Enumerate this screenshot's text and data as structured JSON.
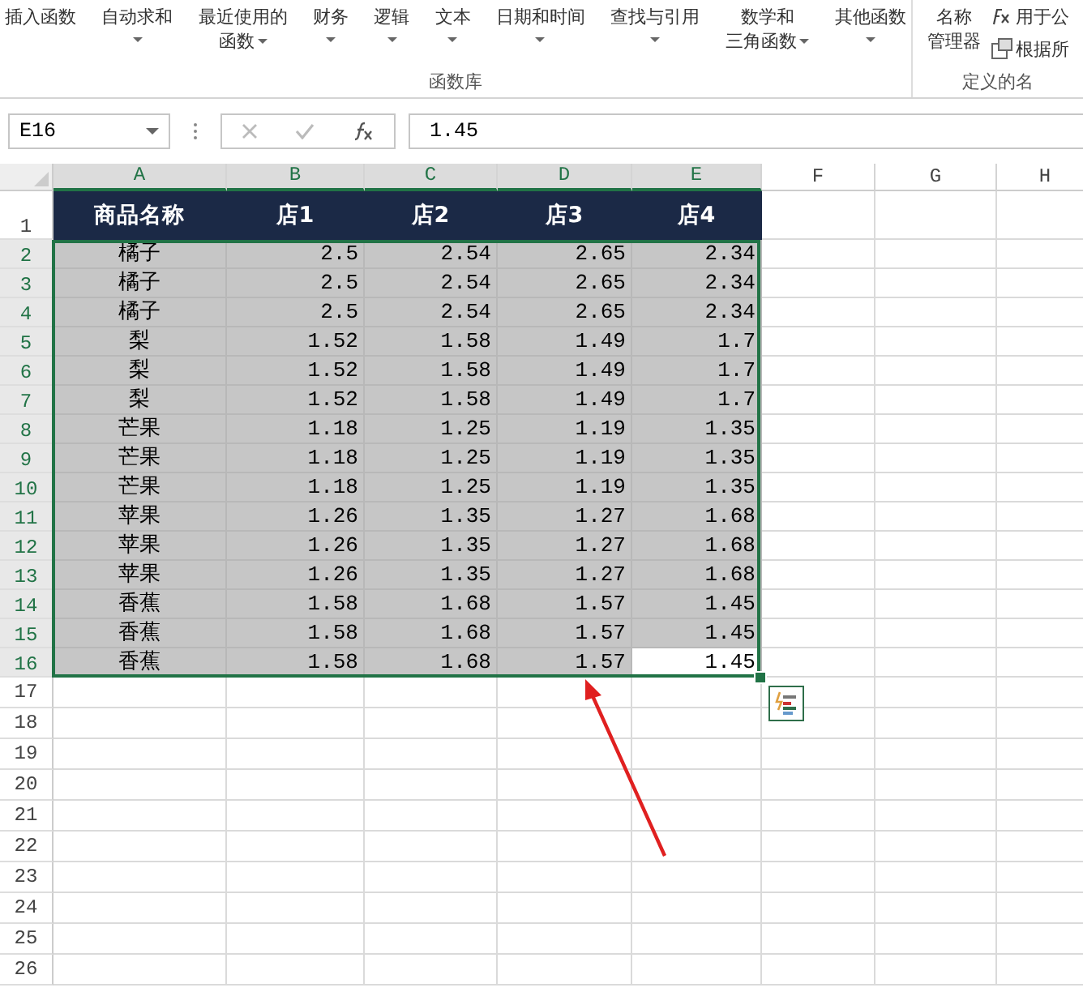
{
  "ribbon": {
    "groups": [
      {
        "label": "函数库",
        "items": [
          {
            "kind": "large",
            "lines": [
              "插入函数"
            ],
            "dropdown": false
          },
          {
            "kind": "large",
            "lines": [
              "自动求和"
            ],
            "dropdown": true
          },
          {
            "kind": "large",
            "lines": [
              "最近使用的",
              "函数"
            ],
            "dropdown": true
          },
          {
            "kind": "large",
            "lines": [
              "财务"
            ],
            "dropdown": true
          },
          {
            "kind": "large",
            "lines": [
              "逻辑"
            ],
            "dropdown": true
          },
          {
            "kind": "large",
            "lines": [
              "文本"
            ],
            "dropdown": true
          },
          {
            "kind": "large",
            "lines": [
              "日期和时间"
            ],
            "dropdown": true
          },
          {
            "kind": "large",
            "lines": [
              "查找与引用"
            ],
            "dropdown": true
          },
          {
            "kind": "large",
            "lines": [
              "数学和",
              "三角函数"
            ],
            "dropdown": true
          },
          {
            "kind": "large",
            "lines": [
              "其他函数"
            ],
            "dropdown": true
          }
        ]
      },
      {
        "label": "定义的名",
        "items": [
          {
            "kind": "large",
            "lines": [
              "名称",
              "管理器"
            ],
            "dropdown": false
          },
          {
            "kind": "small",
            "lines": [
              "用于公"
            ],
            "dropdown": false
          },
          {
            "kind": "small",
            "lines": [
              "根据所"
            ],
            "dropdown": false
          }
        ]
      }
    ]
  },
  "formula_bar": {
    "name_box": "E16",
    "value": "1.45"
  },
  "columns": [
    {
      "label": "A",
      "selected": true
    },
    {
      "label": "B",
      "selected": true
    },
    {
      "label": "C",
      "selected": true
    },
    {
      "label": "D",
      "selected": true
    },
    {
      "label": "E",
      "selected": true
    },
    {
      "label": "F",
      "selected": false
    },
    {
      "label": "G",
      "selected": false
    },
    {
      "label": "H",
      "selected": false
    }
  ],
  "header_row": {
    "number": "1",
    "cells": [
      "商品名称",
      "店1",
      "店2",
      "店3",
      "店4"
    ]
  },
  "rows": [
    {
      "number": "2",
      "cells": [
        {
          "text": "橘子",
          "selected": true
        },
        {
          "text": "2.5",
          "selected": true
        },
        {
          "text": "2.54",
          "selected": true
        },
        {
          "text": "2.65",
          "selected": true
        },
        {
          "text": "2.34",
          "selected": true
        }
      ]
    },
    {
      "number": "3",
      "cells": [
        {
          "text": "橘子",
          "selected": true
        },
        {
          "text": "2.5",
          "selected": true
        },
        {
          "text": "2.54",
          "selected": true
        },
        {
          "text": "2.65",
          "selected": true
        },
        {
          "text": "2.34",
          "selected": true
        }
      ]
    },
    {
      "number": "4",
      "cells": [
        {
          "text": "橘子",
          "selected": true
        },
        {
          "text": "2.5",
          "selected": true
        },
        {
          "text": "2.54",
          "selected": true
        },
        {
          "text": "2.65",
          "selected": true
        },
        {
          "text": "2.34",
          "selected": true
        }
      ]
    },
    {
      "number": "5",
      "cells": [
        {
          "text": "梨",
          "selected": true
        },
        {
          "text": "1.52",
          "selected": true
        },
        {
          "text": "1.58",
          "selected": true
        },
        {
          "text": "1.49",
          "selected": true
        },
        {
          "text": "1.7",
          "selected": true
        }
      ]
    },
    {
      "number": "6",
      "cells": [
        {
          "text": "梨",
          "selected": true
        },
        {
          "text": "1.52",
          "selected": true
        },
        {
          "text": "1.58",
          "selected": true
        },
        {
          "text": "1.49",
          "selected": true
        },
        {
          "text": "1.7",
          "selected": true
        }
      ]
    },
    {
      "number": "7",
      "cells": [
        {
          "text": "梨",
          "selected": true
        },
        {
          "text": "1.52",
          "selected": true
        },
        {
          "text": "1.58",
          "selected": true
        },
        {
          "text": "1.49",
          "selected": true
        },
        {
          "text": "1.7",
          "selected": true
        }
      ]
    },
    {
      "number": "8",
      "cells": [
        {
          "text": "芒果",
          "selected": true
        },
        {
          "text": "1.18",
          "selected": true
        },
        {
          "text": "1.25",
          "selected": true
        },
        {
          "text": "1.19",
          "selected": true
        },
        {
          "text": "1.35",
          "selected": true
        }
      ]
    },
    {
      "number": "9",
      "cells": [
        {
          "text": "芒果",
          "selected": true
        },
        {
          "text": "1.18",
          "selected": true
        },
        {
          "text": "1.25",
          "selected": true
        },
        {
          "text": "1.19",
          "selected": true
        },
        {
          "text": "1.35",
          "selected": true
        }
      ]
    },
    {
      "number": "10",
      "cells": [
        {
          "text": "芒果",
          "selected": true
        },
        {
          "text": "1.18",
          "selected": true
        },
        {
          "text": "1.25",
          "selected": true
        },
        {
          "text": "1.19",
          "selected": true
        },
        {
          "text": "1.35",
          "selected": true
        }
      ]
    },
    {
      "number": "11",
      "cells": [
        {
          "text": "苹果",
          "selected": true
        },
        {
          "text": "1.26",
          "selected": true
        },
        {
          "text": "1.35",
          "selected": true
        },
        {
          "text": "1.27",
          "selected": true
        },
        {
          "text": "1.68",
          "selected": true
        }
      ]
    },
    {
      "number": "12",
      "cells": [
        {
          "text": "苹果",
          "selected": true
        },
        {
          "text": "1.26",
          "selected": true
        },
        {
          "text": "1.35",
          "selected": true
        },
        {
          "text": "1.27",
          "selected": true
        },
        {
          "text": "1.68",
          "selected": true
        }
      ]
    },
    {
      "number": "13",
      "cells": [
        {
          "text": "苹果",
          "selected": true
        },
        {
          "text": "1.26",
          "selected": true
        },
        {
          "text": "1.35",
          "selected": true
        },
        {
          "text": "1.27",
          "selected": true
        },
        {
          "text": "1.68",
          "selected": true
        }
      ]
    },
    {
      "number": "14",
      "cells": [
        {
          "text": "香蕉",
          "selected": true
        },
        {
          "text": "1.58",
          "selected": true
        },
        {
          "text": "1.68",
          "selected": true
        },
        {
          "text": "1.57",
          "selected": true
        },
        {
          "text": "1.45",
          "selected": true
        }
      ]
    },
    {
      "number": "15",
      "cells": [
        {
          "text": "香蕉",
          "selected": true
        },
        {
          "text": "1.58",
          "selected": true
        },
        {
          "text": "1.68",
          "selected": true
        },
        {
          "text": "1.57",
          "selected": true
        },
        {
          "text": "1.45",
          "selected": true
        }
      ]
    },
    {
      "number": "16",
      "cells": [
        {
          "text": "香蕉",
          "selected": true
        },
        {
          "text": "1.58",
          "selected": true
        },
        {
          "text": "1.68",
          "selected": true
        },
        {
          "text": "1.57",
          "selected": true
        },
        {
          "text": "1.45",
          "selected": false
        }
      ]
    }
  ],
  "empty_rows": [
    "17",
    "18",
    "19",
    "20",
    "21",
    "22",
    "23",
    "24",
    "25",
    "26"
  ]
}
